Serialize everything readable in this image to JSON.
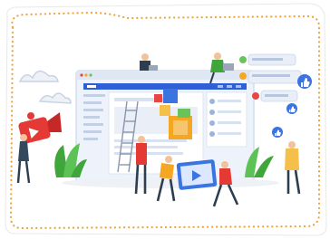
{
  "colors": {
    "frame_dots": "#f0a13a",
    "card_shadow": "#e6e6e6",
    "browser_bar": "#2f5fd6",
    "browser_body": "#eef3fb",
    "browser_frame": "#c9d6ee",
    "panel": "#ffffff",
    "accent_orange": "#f5a623",
    "accent_red": "#e84545",
    "accent_blue": "#3a74e0",
    "accent_green": "#69c35b",
    "plant": "#4db24a",
    "video_red": "#e53935",
    "cloud": "#cfd9e6",
    "skin": "#f2c29c",
    "dark": "#2c3e50"
  },
  "icons": {
    "like": "thumbs-up-icon",
    "play": "play-icon",
    "camera": "video-camera-icon",
    "chat": "chat-bubble-icon"
  }
}
